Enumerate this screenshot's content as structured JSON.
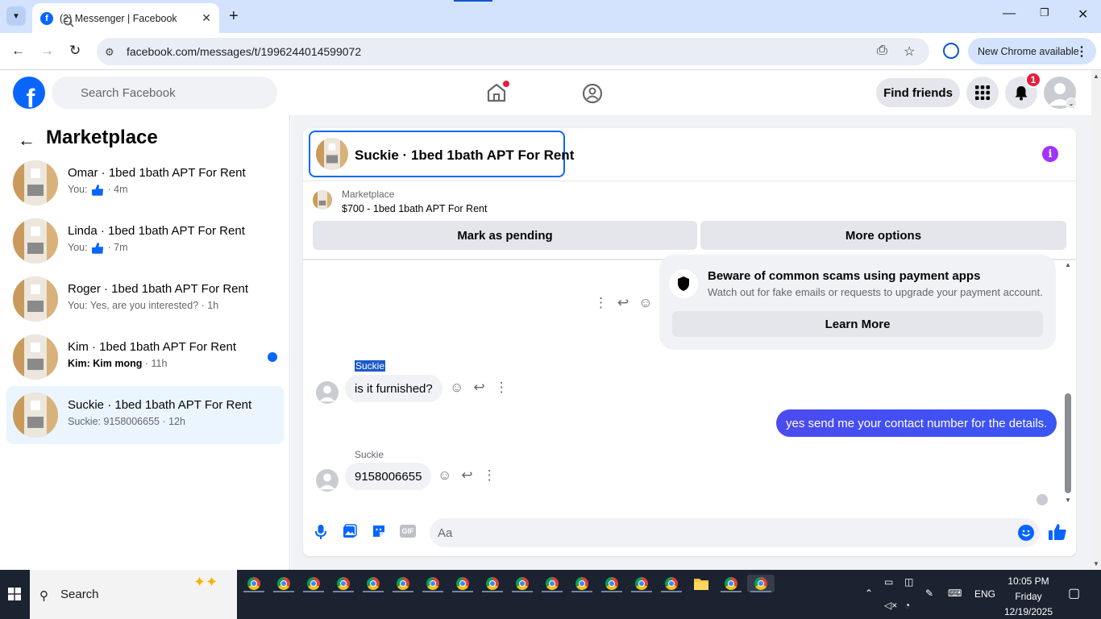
{
  "browser": {
    "tab_title": "(2) Messenger | Facebook",
    "url": "facebook.com/messages/t/1996244014599072",
    "new_chrome_label": "New Chrome available"
  },
  "fb_header": {
    "search_placeholder": "Search Facebook",
    "find_friends": "Find friends",
    "notification_count": "1"
  },
  "sidebar": {
    "title": "Marketplace",
    "conversations": [
      {
        "name": "Omar · 1bed 1bath APT For Rent",
        "prefix": "You: ",
        "time": " · 4m",
        "unread": false,
        "active": false,
        "like": true
      },
      {
        "name": "Linda · 1bed 1bath APT For Rent",
        "prefix": "You: ",
        "time": " · 7m",
        "unread": false,
        "active": false,
        "like": true
      },
      {
        "name": "Roger · 1bed 1bath APT For Rent",
        "preview": "You: Yes, are you interested? · 1h",
        "unread": false,
        "active": false
      },
      {
        "name": "Kim · 1bed 1bath APT For Rent",
        "preview": "Kim: Kim mong",
        "time": " · 11h",
        "unread": true,
        "active": false
      },
      {
        "name": "Suckie · 1bed 1bath APT For Rent",
        "preview": "Suckie: 9158006655 · 12h",
        "unread": false,
        "active": true
      }
    ]
  },
  "chat": {
    "title": "Suckie · 1bed 1bath APT For Rent",
    "marketplace_label": "Marketplace",
    "listing": "$700 - 1bed 1bath APT For Rent",
    "mark_pending": "Mark as pending",
    "more_options": "More options",
    "scam_title": "Beware of common scams using payment apps",
    "scam_sub": "Watch out for fake emails or requests to upgrade your payment account.",
    "learn_more": "Learn More",
    "messages": [
      {
        "sender": "Suckie",
        "text": "is it furnished?",
        "direction": "in"
      },
      {
        "text": "yes send me your contact number for the details.",
        "direction": "out"
      },
      {
        "sender": "Suckie",
        "text": "9158006655",
        "direction": "in"
      }
    ],
    "composer_placeholder": "Aa"
  },
  "taskbar": {
    "search_label": "Search",
    "lang": "ENG",
    "time": "10:05 PM",
    "day": "Friday",
    "date": "12/19/2025"
  }
}
